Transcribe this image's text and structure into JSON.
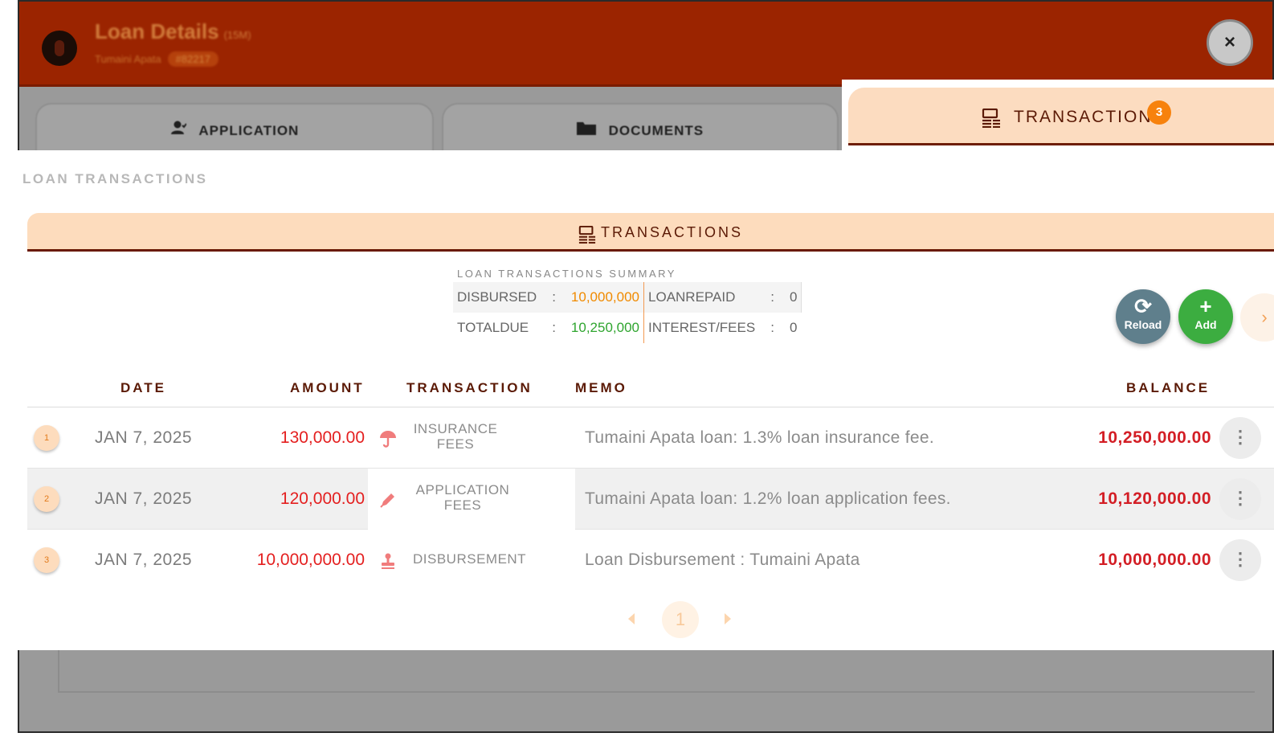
{
  "background_modal": {
    "title": "Loan Details",
    "title_suffix": "(15M)",
    "borrower": "Tumaini Apata",
    "loan_id": "#82217",
    "close_label": "×",
    "tabs": [
      {
        "label": "APPLICATION",
        "icon": "user-icon"
      },
      {
        "label": "DOCUMENTS",
        "icon": "folder-icon"
      }
    ]
  },
  "active_tab": {
    "label": "TRANSACTIONS",
    "icon": "transactions-icon",
    "badge": "3"
  },
  "section_label": "LOAN TRANSACTIONS",
  "card": {
    "title": "TRANSACTIONS",
    "icon": "transactions-icon"
  },
  "summary": {
    "title": "LOAN TRANSACTIONS SUMMARY",
    "colon": ":",
    "disbursed_label": "DISBURSED",
    "disbursed_value": "10,000,000",
    "loanrepaid_label": "LOANREPAID",
    "loanrepaid_value": "0",
    "totaldue_label": "TOTALDUE",
    "totaldue_value": "10,250,000",
    "interest_label": "INTEREST/FEES",
    "interest_value": "0"
  },
  "actions": {
    "reload_label": "Reload",
    "add_label": "Add"
  },
  "table": {
    "headers": {
      "date": "DATE",
      "amount": "AMOUNT",
      "transaction": "TRANSACTION",
      "memo": "MEMO",
      "balance": "BALANCE"
    },
    "rows": [
      {
        "num": "1",
        "date": "JAN 7, 2025",
        "amount": "130,000.00",
        "type_line1": "INSURANCE",
        "type_line2": "FEES",
        "type_icon": "umbrella-icon",
        "memo": "Tumaini Apata loan: 1.3% loan insurance fee.",
        "balance": "10,250,000.00"
      },
      {
        "num": "2",
        "date": "JAN 7, 2025",
        "amount": "120,000.00",
        "type_line1": "APPLICATION",
        "type_line2": "FEES",
        "type_icon": "pen-icon",
        "memo": "Tumaini Apata loan: 1.2% loan application fees.",
        "balance": "10,120,000.00"
      },
      {
        "num": "3",
        "date": "JAN 7, 2025",
        "amount": "10,000,000.00",
        "type_line1": "DISBURSEMENT",
        "type_line2": "",
        "type_icon": "stamp-icon",
        "memo": "Loan Disbursement : Tumaini Apata",
        "balance": "10,000,000.00"
      }
    ]
  },
  "pagination": {
    "current_page": "1"
  },
  "colors": {
    "header_bg": "#9b2400",
    "tab_active_bg": "#fcdcc0",
    "accent_dark": "#5b1a06",
    "amount_red": "#e41f1f",
    "balance_red": "#d31e25",
    "disbursed_orange": "#f08a00",
    "totaldue_green": "#2fa52f",
    "reload_bg": "#5f7f8c",
    "add_bg": "#3cad40",
    "badge_orange": "#f7820d"
  }
}
